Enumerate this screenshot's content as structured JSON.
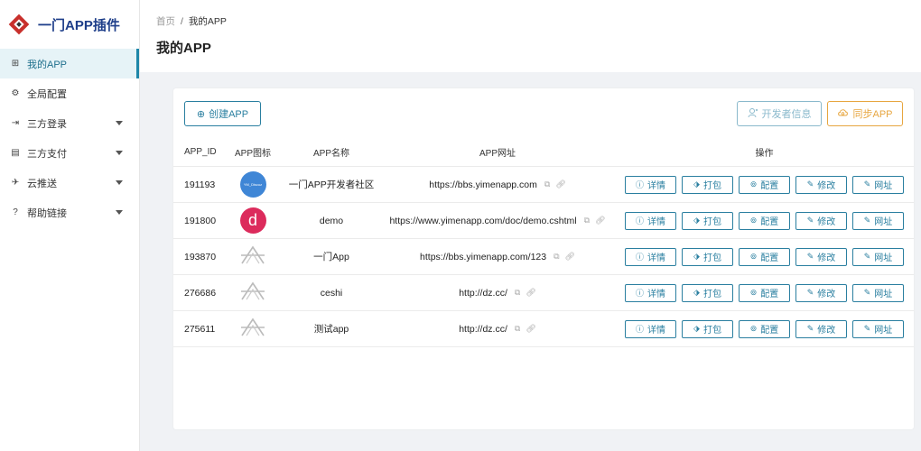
{
  "sidebar": {
    "logo_text": "一门APP插件",
    "items": [
      {
        "label": "我的APP",
        "icon": "grid-icon",
        "glyph": "⊞"
      },
      {
        "label": "全局配置",
        "icon": "settings-icon",
        "glyph": "⚙"
      },
      {
        "label": "三方登录",
        "icon": "login-icon",
        "glyph": "⇥"
      },
      {
        "label": "三方支付",
        "icon": "payment-icon",
        "glyph": "▤"
      },
      {
        "label": "云推送",
        "icon": "push-icon",
        "glyph": "✈"
      },
      {
        "label": "帮助链接",
        "icon": "help-icon",
        "glyph": "?"
      }
    ]
  },
  "header": {
    "breadcrumb_home": "首页",
    "breadcrumb_sep": "/",
    "breadcrumb_current": "我的APP",
    "title": "我的APP"
  },
  "toolbar": {
    "create_label": "创建APP",
    "dev_info_label": "开发者信息",
    "sync_label": "同步APP"
  },
  "table": {
    "headers": {
      "id": "APP_ID",
      "icon": "APP图标",
      "name": "APP名称",
      "url": "APP网址",
      "ops": "操作"
    },
    "op_labels": {
      "detail": "详情",
      "package": "打包",
      "config": "配置",
      "edit": "修改",
      "url": "网址"
    },
    "rows": [
      {
        "id": "191193",
        "name": "一门APP开发者社区",
        "url": "https://bbs.yimenapp.com",
        "icon_text": "YM_Discuz"
      },
      {
        "id": "191800",
        "name": "demo",
        "url": "https://www.yimenapp.com/doc/demo.cshtml",
        "icon_text": "d"
      },
      {
        "id": "193870",
        "name": "一门App",
        "url": "https://bbs.yimenapp.com/123",
        "icon_text": ""
      },
      {
        "id": "276686",
        "name": "ceshi",
        "url": "http://dz.cc/",
        "icon_text": ""
      },
      {
        "id": "275611",
        "name": "测试app",
        "url": "http://dz.cc/",
        "icon_text": ""
      }
    ]
  },
  "colors": {
    "accent": "#2a7fa0",
    "brand": "#1f3f8a",
    "logo_red": "#c8302c",
    "sync_orange": "#e7a640"
  }
}
